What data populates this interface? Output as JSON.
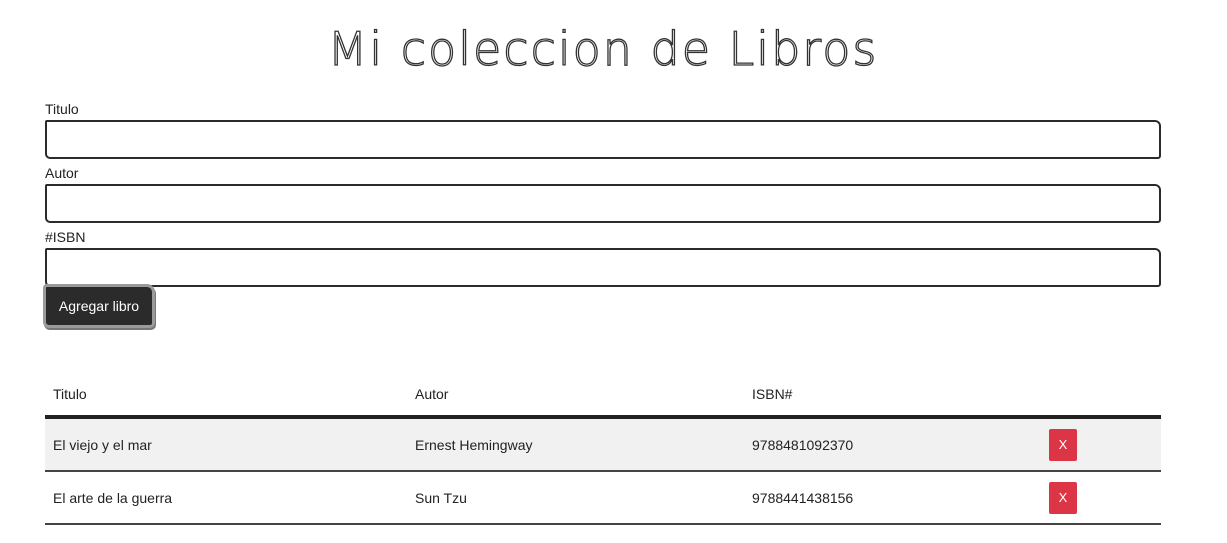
{
  "header": {
    "title": "Mi coleccion de Libros"
  },
  "form": {
    "fields": [
      {
        "label": "Titulo",
        "value": "",
        "placeholder": ""
      },
      {
        "label": "Autor",
        "value": "",
        "placeholder": ""
      },
      {
        "label": "#ISBN",
        "value": "",
        "placeholder": ""
      }
    ],
    "submit_label": "Agregar libro"
  },
  "table": {
    "headers": [
      "Titulo",
      "Autor",
      "ISBN#",
      ""
    ],
    "rows": [
      {
        "titulo": "El viejo y el mar",
        "autor": "Ernest Hemingway",
        "isbn": "9788481092370",
        "delete_label": "X"
      },
      {
        "titulo": "El arte de la guerra",
        "autor": "Sun Tzu",
        "isbn": "9788441438156",
        "delete_label": "X"
      }
    ]
  },
  "colors": {
    "button_dark": "#2b2b2b",
    "delete_red": "#dc3545",
    "row_stripe": "#f1f1f1"
  }
}
